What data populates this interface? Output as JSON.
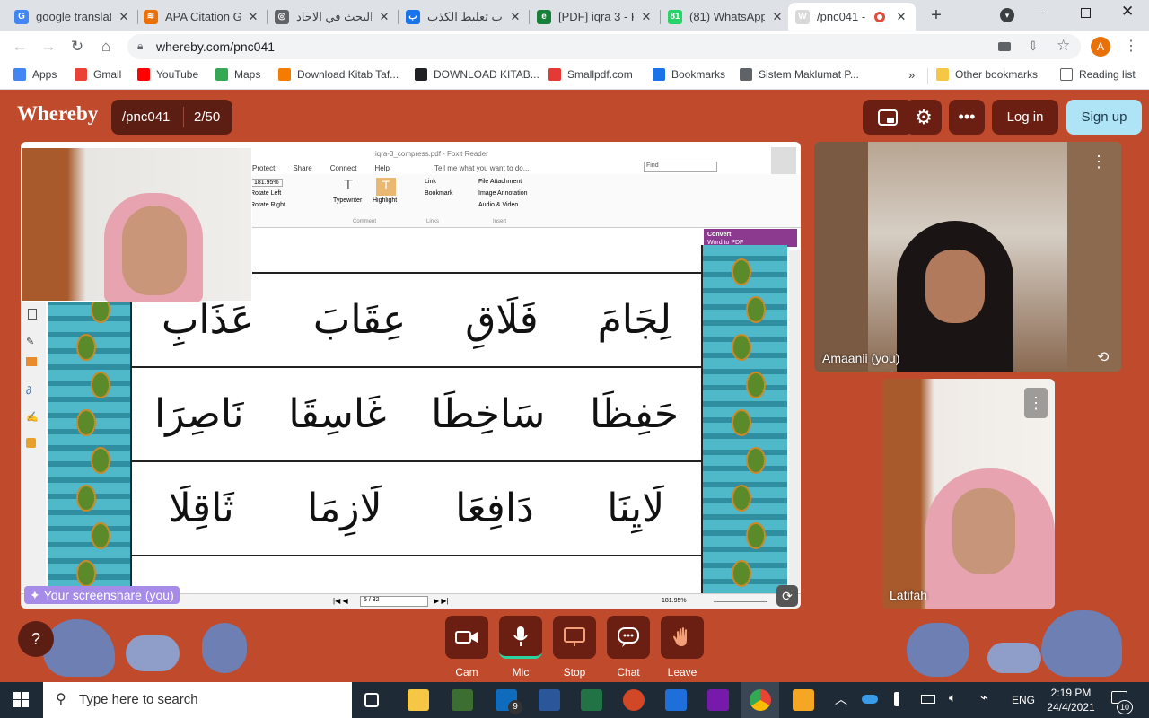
{
  "browser": {
    "tabs": [
      {
        "label": "google translat",
        "icon": "google-icon",
        "color": "#4285f4",
        "glyph": "G"
      },
      {
        "label": "APA Citation Gu",
        "icon": "citation-icon",
        "color": "#e8710a",
        "glyph": "≋"
      },
      {
        "label": "البحث في الاحاد",
        "icon": "globe-icon",
        "color": "#5f6368",
        "glyph": "◎"
      },
      {
        "label": "باب تعليط الكذب",
        "icon": "bookmark-site-icon",
        "color": "#1a73e8",
        "glyph": "ب"
      },
      {
        "label": "[PDF] iqra 3 - F",
        "icon": "edge-icon",
        "color": "#188038",
        "glyph": "e"
      },
      {
        "label": "(81) WhatsApp",
        "icon": "whatsapp-icon",
        "color": "#25d366",
        "glyph": "81"
      },
      {
        "label": "/pnc041 - ",
        "icon": "whereby-icon",
        "color": "#d9d9d9",
        "glyph": "W",
        "active": true
      }
    ],
    "new_tab": "+",
    "url": "whereby.com/pnc041",
    "profile_initial": "A",
    "bookmarks": [
      {
        "label": "Apps",
        "color": "#4285f4"
      },
      {
        "label": "Gmail",
        "color": "#ea4335"
      },
      {
        "label": "YouTube",
        "color": "#ff0000"
      },
      {
        "label": "Maps",
        "color": "#34a853"
      },
      {
        "label": "Download Kitab Taf...",
        "color": "#f57c00"
      },
      {
        "label": "DOWNLOAD KITAB...",
        "color": "#202124"
      },
      {
        "label": "Smallpdf.com",
        "color": "#e53935"
      },
      {
        "label": "Bookmarks",
        "color": "#1a73e8"
      },
      {
        "label": "Sistem Maklumat P...",
        "color": "#5f6368"
      }
    ],
    "overflow": "»",
    "other_bookmarks": "Other bookmarks",
    "reading_list": "Reading list"
  },
  "whereby": {
    "logo": "Whereby",
    "room": "/pnc041",
    "count": "2/50",
    "login": "Log in",
    "signup": "Sign up",
    "accent": "#bf4a2c",
    "dark": "#6b1f12",
    "signup_bg": "#aee4f5"
  },
  "screenshare": {
    "label": "Your screenshare (you)",
    "reader": {
      "title": "iqra-3_compress.pdf - Foxit Reader",
      "menu": [
        "Protect",
        "Share",
        "Connect",
        "Help"
      ],
      "tellme": "Tell me what you want to do...",
      "find": "Find",
      "zoom": "181.95%",
      "rotate_left": "Rotate Left",
      "rotate_right": "Rotate Right",
      "typewriter": "Typewriter",
      "highlight": "Highlight",
      "comment_group": "Comment",
      "link": "Link",
      "bookmark": "Bookmark",
      "links_group": "Links",
      "file_attachment": "File Attachment",
      "image_annotation": "Image Annotation",
      "audio_video": "Audio & Video",
      "insert_group": "Insert",
      "convert": "Convert",
      "word_to_pdf": "Word to PDF",
      "page": "5 / 32",
      "status_zoom": "181.95%"
    },
    "rows": [
      [
        "لِجَامَ",
        "فَلَاقِ",
        "عِقَابَ",
        "عَذَابِ"
      ],
      [
        "حَفِظَا",
        "سَاخِطَا",
        "غَاسِقَا",
        "نَاصِرَا"
      ],
      [
        "لَايِنَا",
        "دَافِعَا",
        "لَازِمَا",
        "ثَاقِلَا"
      ]
    ]
  },
  "participants": [
    {
      "name": "Amaanii (you)"
    },
    {
      "name": "Latifah"
    }
  ],
  "controls": [
    {
      "label": "Cam",
      "icon": "camera-icon"
    },
    {
      "label": "Mic",
      "icon": "microphone-icon"
    },
    {
      "label": "Stop",
      "icon": "screenshare-stop-icon"
    },
    {
      "label": "Chat",
      "icon": "chat-icon"
    },
    {
      "label": "Leave",
      "icon": "hand-wave-icon"
    }
  ],
  "help": "?",
  "taskbar": {
    "search": "Type here to search",
    "lang": "ENG",
    "time": "2:19 PM",
    "date": "24/4/2021",
    "notifications": "10",
    "mail_badge": "9"
  }
}
